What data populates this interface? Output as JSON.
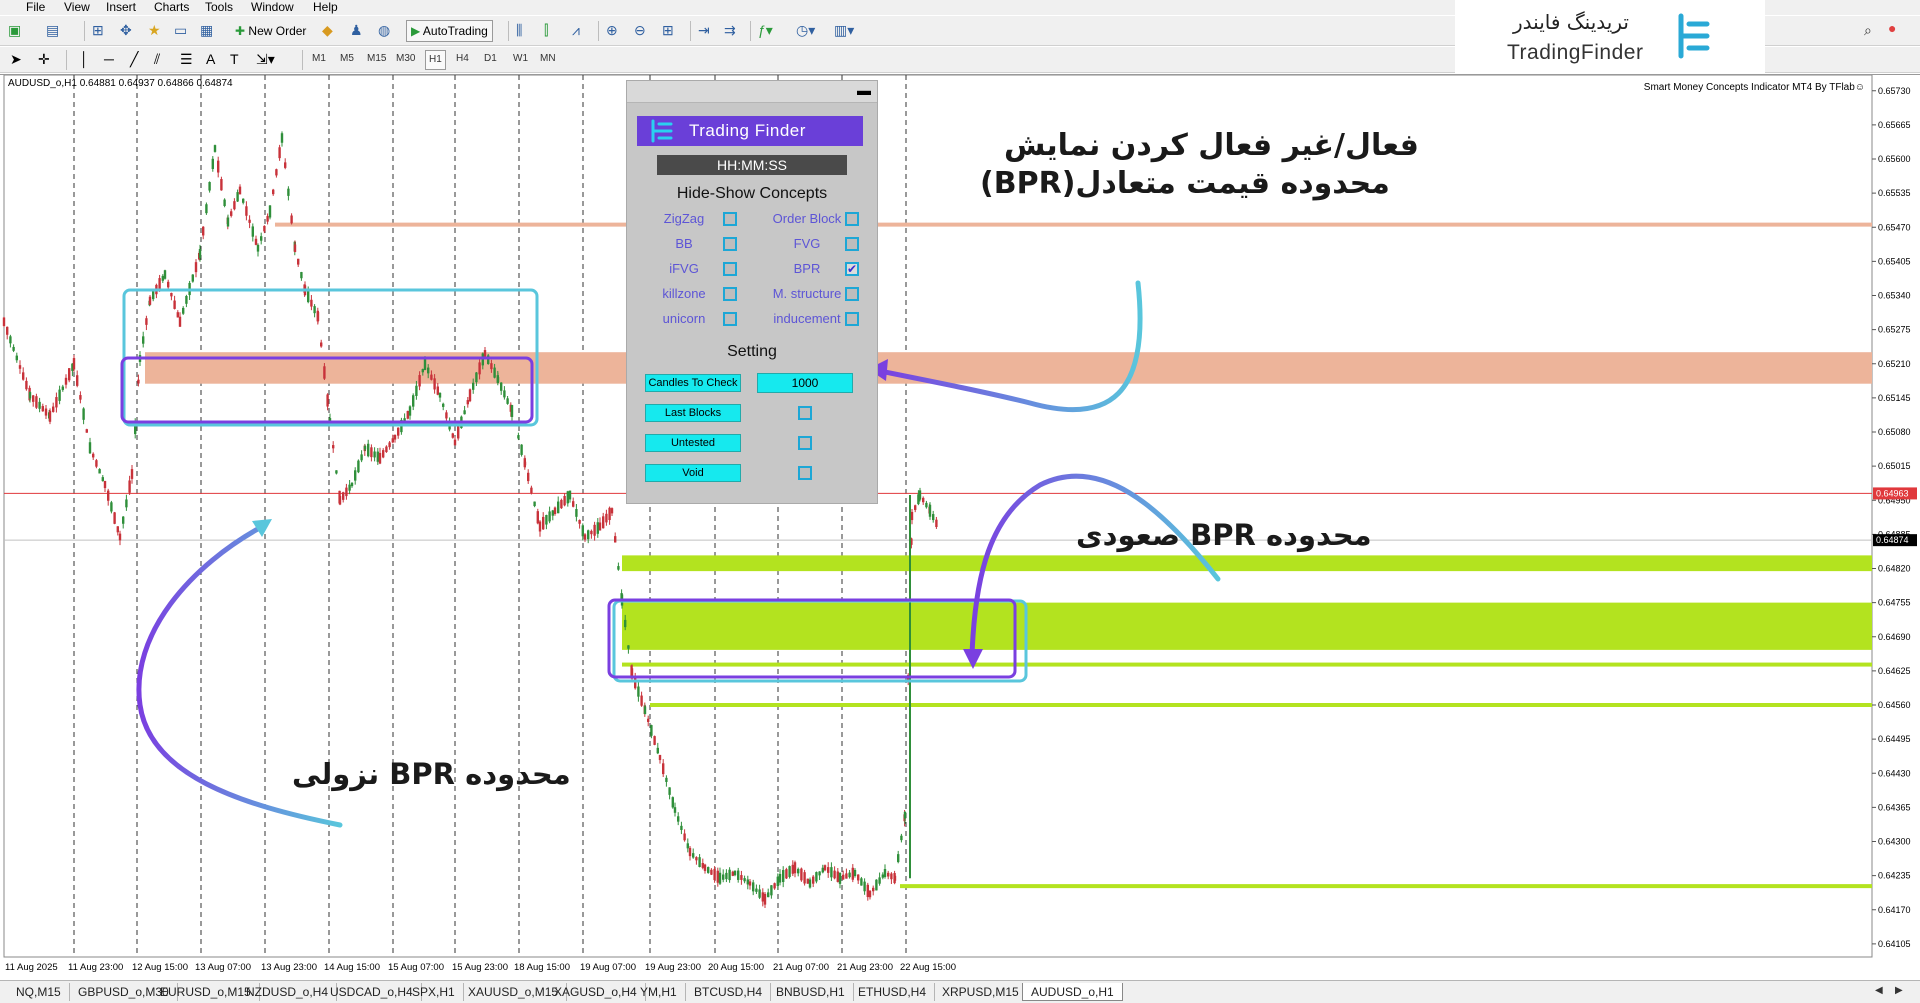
{
  "menu": [
    "File",
    "View",
    "Insert",
    "Charts",
    "Tools",
    "Window",
    "Help"
  ],
  "toolbar": {
    "new_order": "New Order",
    "auto_trading": "AutoTrading",
    "timeframes": [
      "M1",
      "M5",
      "M15",
      "M30",
      "H1",
      "H4",
      "D1",
      "W1",
      "MN"
    ],
    "active_timeframe": "H1"
  },
  "logo": {
    "persian": "تریدینگ فایندر",
    "english": "TradingFinder"
  },
  "chart": {
    "symbol_info": "AUDUSD_o,H1  0.64881 0.64937 0.64866 0.64874",
    "indicator_label": "Smart Money Concepts Indicator MT4 By TFlab☺",
    "price_axis": [
      "0.65730",
      "0.65665",
      "0.65600",
      "0.65535",
      "0.65470",
      "0.65405",
      "0.65340",
      "0.65275",
      "0.65210",
      "0.65145",
      "0.65080",
      "0.65015",
      "0.64963",
      "0.64950",
      "0.64885",
      "0.64874",
      "0.64820",
      "0.64755",
      "0.64690",
      "0.64625",
      "0.64560",
      "0.64495",
      "0.64430",
      "0.64365",
      "0.64300",
      "0.64235",
      "0.64170",
      "0.64105"
    ],
    "current_price": "0.64963",
    "bid_price": "0.64874",
    "time_axis": [
      "11 Aug 2025",
      "11 Aug 23:00",
      "12 Aug 15:00",
      "13 Aug 07:00",
      "13 Aug 23:00",
      "14 Aug 15:00",
      "15 Aug 07:00",
      "15 Aug 23:00",
      "18 Aug 15:00",
      "19 Aug 07:00",
      "19 Aug 23:00",
      "20 Aug 15:00",
      "21 Aug 07:00",
      "21 Aug 23:00",
      "22 Aug 15:00"
    ]
  },
  "panel": {
    "brand": "Trading Finder",
    "clock": "HH:MM:SS",
    "concepts_title": "Hide-Show Concepts",
    "concepts": [
      {
        "left": "ZigZag",
        "left_checked": false,
        "right": "Order Block",
        "right_checked": false
      },
      {
        "left": "BB",
        "left_checked": false,
        "right": "FVG",
        "right_checked": false
      },
      {
        "left": "iFVG",
        "left_checked": false,
        "right": "BPR",
        "right_checked": true
      },
      {
        "left": "killzone",
        "left_checked": false,
        "right": "M. structure",
        "right_checked": false
      },
      {
        "left": "unicorn",
        "left_checked": false,
        "right": "inducement",
        "right_checked": false
      }
    ],
    "setting_title": "Setting",
    "candles_label": "Candles To Check",
    "candles_value": "1000",
    "settings": [
      "Last Blocks",
      "Untested",
      "Void"
    ]
  },
  "annotations": {
    "toggle_line1": "فعال/غیر فعال کردن نمایش",
    "toggle_line2": "محدوده قیمت متعادل(BPR)",
    "bullish": "محدوده  BPR صعودی",
    "bearish": "محدوده  BPR نزولی"
  },
  "tabs": [
    "NQ,M15",
    "GBPUSD_o,M30",
    "EURUSD_o,M15",
    "NZDUSD_o,H4",
    "USDCAD_o,H4",
    "SPX,H1",
    "XAUUSD_o,M15",
    "XAGUSD_o,H4",
    "YM,H1",
    "BTCUSD,H4",
    "BNBUSD,H1",
    "ETHUSD,H4",
    "XRPUSD,M15",
    "AUDUSD_o,H1"
  ],
  "active_tab": "AUDUSD_o,H1",
  "colors": {
    "bearish_zone": "#edb49a",
    "bullish_zone": "#b3e31f",
    "bpr_outline_inner": "#7a3fe0",
    "bpr_outline_outer": "#59c6dc",
    "current_price_line": "#e0383c",
    "brand": "#6a3fd8"
  }
}
